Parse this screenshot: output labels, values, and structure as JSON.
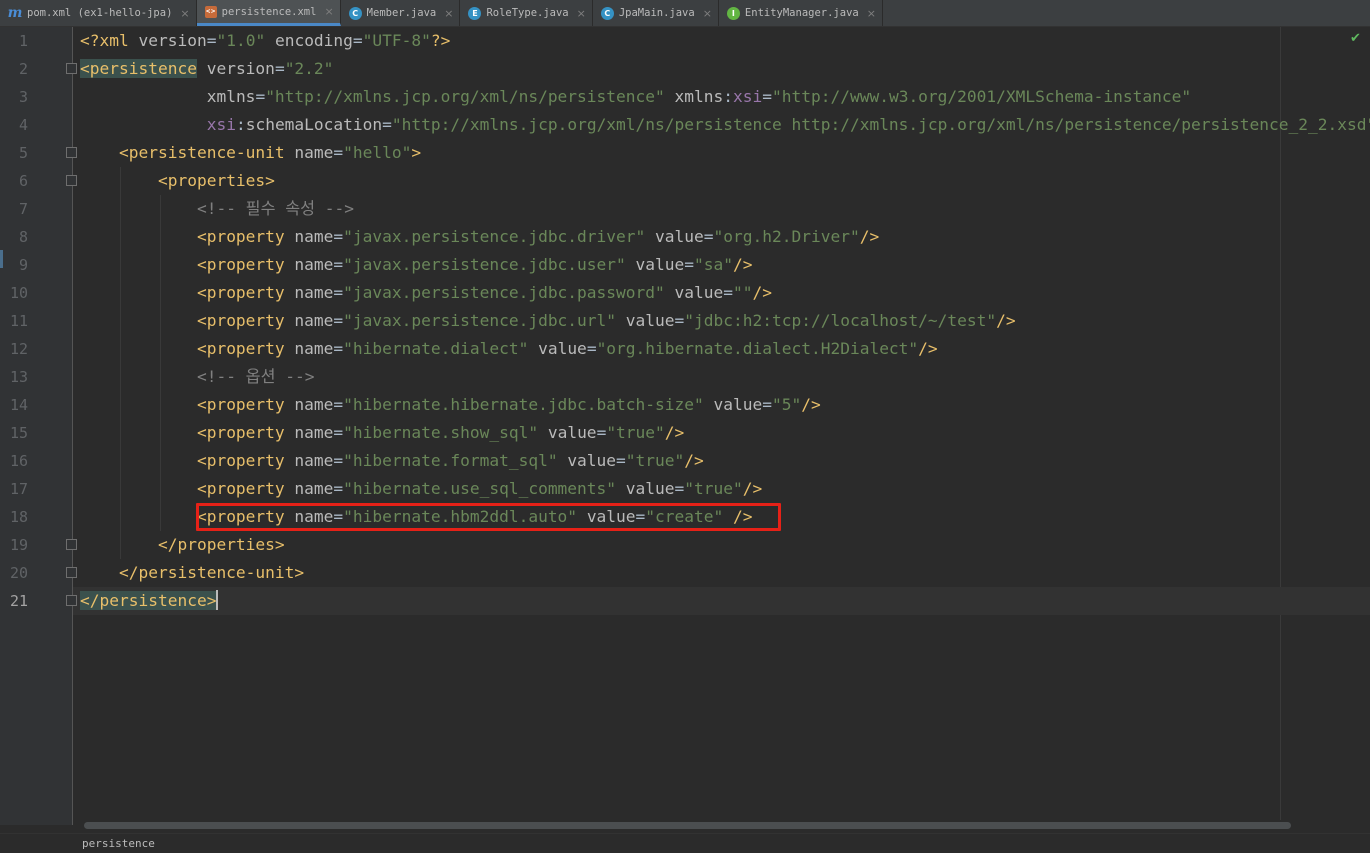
{
  "tabs": [
    {
      "label": "pom.xml (ex1-hello-jpa)",
      "icon": "maven-icon",
      "icon_glyph": "m",
      "kind": "maven",
      "active": false
    },
    {
      "label": "persistence.xml",
      "icon": "xml-file-icon",
      "icon_glyph": "<>",
      "kind": "xml",
      "active": true
    },
    {
      "label": "Member.java",
      "icon": "class-icon",
      "icon_glyph": "C",
      "kind": "cls",
      "active": false
    },
    {
      "label": "RoleType.java",
      "icon": "enum-icon",
      "icon_glyph": "E",
      "kind": "enum",
      "active": false
    },
    {
      "label": "JpaMain.java",
      "icon": "main-class-icon",
      "icon_glyph": "C",
      "kind": "main",
      "active": false
    },
    {
      "label": "EntityManager.java",
      "icon": "interface-icon",
      "icon_glyph": "I",
      "kind": "iface",
      "active": false
    }
  ],
  "editor": {
    "current_line": 21,
    "lines": [
      {
        "n": "1",
        "tokens": [
          [
            "tag",
            "<?xml "
          ],
          [
            "attr",
            "version"
          ],
          [
            "plain",
            "="
          ],
          [
            "val",
            "\"1.0\""
          ],
          [
            "plain",
            " "
          ],
          [
            "attr",
            "encoding"
          ],
          [
            "plain",
            "="
          ],
          [
            "val",
            "\"UTF-8\""
          ],
          [
            "tag",
            "?>"
          ]
        ]
      },
      {
        "n": "2",
        "fold": true,
        "tokens": [
          [
            "tagm",
            "<persistence"
          ],
          [
            "plain",
            " "
          ],
          [
            "attr",
            "version"
          ],
          [
            "plain",
            "="
          ],
          [
            "val",
            "\"2.2\""
          ]
        ]
      },
      {
        "n": "3",
        "tokens": [
          [
            "plain",
            "             "
          ],
          [
            "attr",
            "xmlns"
          ],
          [
            "plain",
            "="
          ],
          [
            "val",
            "\"http://xmlns.jcp.org/xml/ns/persistence\""
          ],
          [
            "plain",
            " "
          ],
          [
            "attr",
            "xmlns"
          ],
          [
            "plain",
            ":"
          ],
          [
            "ns",
            "xsi"
          ],
          [
            "plain",
            "="
          ],
          [
            "val",
            "\"http://www.w3.org/2001/XMLSchema-instance\""
          ]
        ]
      },
      {
        "n": "4",
        "tokens": [
          [
            "plain",
            "             "
          ],
          [
            "ns",
            "xsi"
          ],
          [
            "plain",
            ":"
          ],
          [
            "attr",
            "schemaLocation"
          ],
          [
            "plain",
            "="
          ],
          [
            "val",
            "\"http://xmlns.jcp.org/xml/ns/persistence http://xmlns.jcp.org/xml/ns/persistence/persistence_2_2.xsd\""
          ],
          [
            "tag",
            ">"
          ]
        ]
      },
      {
        "n": "5",
        "fold": true,
        "tokens": [
          [
            "plain",
            "    "
          ],
          [
            "tag",
            "<persistence-unit "
          ],
          [
            "attr",
            "name"
          ],
          [
            "plain",
            "="
          ],
          [
            "val",
            "\"hello\""
          ],
          [
            "tag",
            ">"
          ]
        ]
      },
      {
        "n": "6",
        "fold": true,
        "tokens": [
          [
            "plain",
            "        "
          ],
          [
            "tag",
            "<properties>"
          ]
        ]
      },
      {
        "n": "7",
        "tokens": [
          [
            "plain",
            "            "
          ],
          [
            "cmt",
            "<!-- 필수 속성 -->"
          ]
        ]
      },
      {
        "n": "8",
        "tokens": [
          [
            "plain",
            "            "
          ],
          [
            "tag",
            "<property "
          ],
          [
            "attr",
            "name"
          ],
          [
            "plain",
            "="
          ],
          [
            "val",
            "\"javax.persistence.jdbc.driver\""
          ],
          [
            "plain",
            " "
          ],
          [
            "attr",
            "value"
          ],
          [
            "plain",
            "="
          ],
          [
            "val",
            "\"org.h2.Driver\""
          ],
          [
            "tag",
            "/>"
          ]
        ]
      },
      {
        "n": "9",
        "tokens": [
          [
            "plain",
            "            "
          ],
          [
            "tag",
            "<property "
          ],
          [
            "attr",
            "name"
          ],
          [
            "plain",
            "="
          ],
          [
            "val",
            "\"javax.persistence.jdbc.user\""
          ],
          [
            "plain",
            " "
          ],
          [
            "attr",
            "value"
          ],
          [
            "plain",
            "="
          ],
          [
            "val",
            "\"sa\""
          ],
          [
            "tag",
            "/>"
          ]
        ]
      },
      {
        "n": "10",
        "tokens": [
          [
            "plain",
            "            "
          ],
          [
            "tag",
            "<property "
          ],
          [
            "attr",
            "name"
          ],
          [
            "plain",
            "="
          ],
          [
            "val",
            "\"javax.persistence.jdbc.password\""
          ],
          [
            "plain",
            " "
          ],
          [
            "attr",
            "value"
          ],
          [
            "plain",
            "="
          ],
          [
            "val",
            "\"\""
          ],
          [
            "tag",
            "/>"
          ]
        ]
      },
      {
        "n": "11",
        "tokens": [
          [
            "plain",
            "            "
          ],
          [
            "tag",
            "<property "
          ],
          [
            "attr",
            "name"
          ],
          [
            "plain",
            "="
          ],
          [
            "val",
            "\"javax.persistence.jdbc.url\""
          ],
          [
            "plain",
            " "
          ],
          [
            "attr",
            "value"
          ],
          [
            "plain",
            "="
          ],
          [
            "val",
            "\"jdbc:h2:tcp://localhost/~/test\""
          ],
          [
            "tag",
            "/>"
          ]
        ]
      },
      {
        "n": "12",
        "tokens": [
          [
            "plain",
            "            "
          ],
          [
            "tag",
            "<property "
          ],
          [
            "attr",
            "name"
          ],
          [
            "plain",
            "="
          ],
          [
            "val",
            "\"hibernate.dialect\""
          ],
          [
            "plain",
            " "
          ],
          [
            "attr",
            "value"
          ],
          [
            "plain",
            "="
          ],
          [
            "val",
            "\"org.hibernate.dialect.H2Dialect\""
          ],
          [
            "tag",
            "/>"
          ]
        ]
      },
      {
        "n": "13",
        "tokens": [
          [
            "plain",
            "            "
          ],
          [
            "cmt",
            "<!-- 옵션 -->"
          ]
        ]
      },
      {
        "n": "14",
        "tokens": [
          [
            "plain",
            "            "
          ],
          [
            "tag",
            "<property "
          ],
          [
            "attr",
            "name"
          ],
          [
            "plain",
            "="
          ],
          [
            "val",
            "\"hibernate.hibernate.jdbc.batch-size\""
          ],
          [
            "plain",
            " "
          ],
          [
            "attr",
            "value"
          ],
          [
            "plain",
            "="
          ],
          [
            "val",
            "\"5\""
          ],
          [
            "tag",
            "/>"
          ]
        ]
      },
      {
        "n": "15",
        "tokens": [
          [
            "plain",
            "            "
          ],
          [
            "tag",
            "<property "
          ],
          [
            "attr",
            "name"
          ],
          [
            "plain",
            "="
          ],
          [
            "val",
            "\"hibernate.show_sql\""
          ],
          [
            "plain",
            " "
          ],
          [
            "attr",
            "value"
          ],
          [
            "plain",
            "="
          ],
          [
            "val",
            "\"true\""
          ],
          [
            "tag",
            "/>"
          ]
        ]
      },
      {
        "n": "16",
        "tokens": [
          [
            "plain",
            "            "
          ],
          [
            "tag",
            "<property "
          ],
          [
            "attr",
            "name"
          ],
          [
            "plain",
            "="
          ],
          [
            "val",
            "\"hibernate.format_sql\""
          ],
          [
            "plain",
            " "
          ],
          [
            "attr",
            "value"
          ],
          [
            "plain",
            "="
          ],
          [
            "val",
            "\"true\""
          ],
          [
            "tag",
            "/>"
          ]
        ]
      },
      {
        "n": "17",
        "tokens": [
          [
            "plain",
            "            "
          ],
          [
            "tag",
            "<property "
          ],
          [
            "attr",
            "name"
          ],
          [
            "plain",
            "="
          ],
          [
            "val",
            "\"hibernate.use_sql_comments\""
          ],
          [
            "plain",
            " "
          ],
          [
            "attr",
            "value"
          ],
          [
            "plain",
            "="
          ],
          [
            "val",
            "\"true\""
          ],
          [
            "tag",
            "/>"
          ]
        ]
      },
      {
        "n": "18",
        "tokens": [
          [
            "plain",
            "            "
          ],
          [
            "tag",
            "<property "
          ],
          [
            "attr",
            "name"
          ],
          [
            "plain",
            "="
          ],
          [
            "val",
            "\"hibernate.hbm2ddl.auto\""
          ],
          [
            "plain",
            " "
          ],
          [
            "attr",
            "value"
          ],
          [
            "plain",
            "="
          ],
          [
            "val",
            "\"create\""
          ],
          [
            "plain",
            " "
          ],
          [
            "tag",
            "/>"
          ]
        ]
      },
      {
        "n": "19",
        "fold": true,
        "tokens": [
          [
            "plain",
            "        "
          ],
          [
            "tag",
            "</properties>"
          ]
        ]
      },
      {
        "n": "20",
        "fold": true,
        "tokens": [
          [
            "plain",
            "    "
          ],
          [
            "tag",
            "</persistence-unit>"
          ]
        ]
      },
      {
        "n": "21",
        "fold": true,
        "caret": true,
        "tokens": [
          [
            "tagm",
            "</persistence>"
          ]
        ]
      }
    ]
  },
  "breadcrumb": {
    "path": "persistence"
  },
  "colors": {
    "highlight_box": "#e62117",
    "tag": "#e8bf6a",
    "attr": "#bababa",
    "value": "#6a8759",
    "comment": "#808080",
    "namespace": "#9876aa"
  }
}
